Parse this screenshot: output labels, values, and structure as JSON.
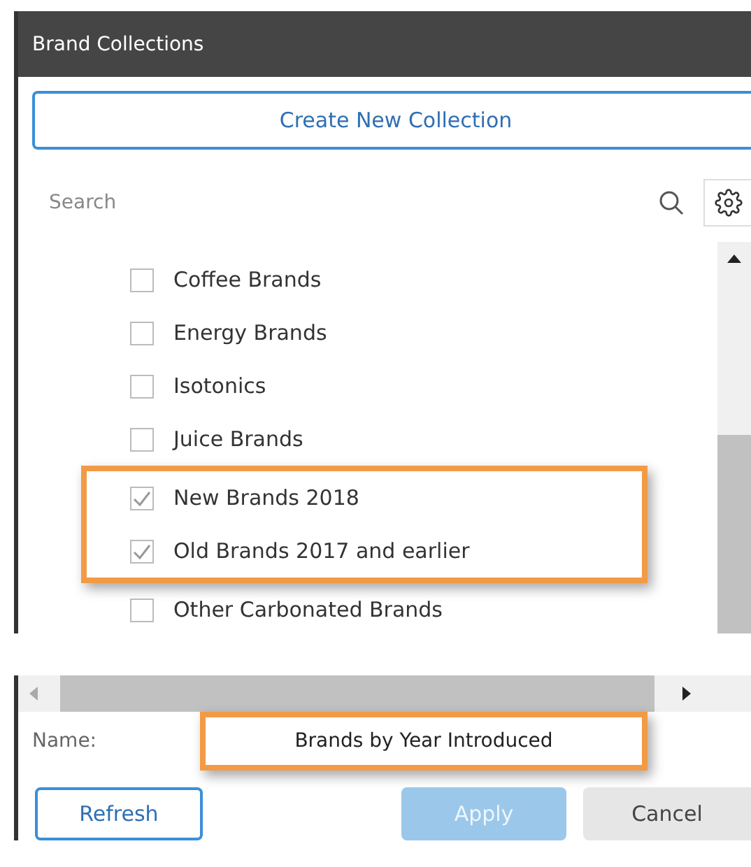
{
  "window": {
    "title": "Brand Collections"
  },
  "create_button": {
    "label": "Create New Collection"
  },
  "search": {
    "placeholder": "Search"
  },
  "collections": [
    {
      "label": "Coffee Brands",
      "checked": false,
      "highlighted": false
    },
    {
      "label": "Energy Brands",
      "checked": false,
      "highlighted": false
    },
    {
      "label": "Isotonics",
      "checked": false,
      "highlighted": false
    },
    {
      "label": "Juice Brands",
      "checked": false,
      "highlighted": false
    },
    {
      "label": "New Brands 2018",
      "checked": true,
      "highlighted": true
    },
    {
      "label": "Old Brands 2017 and earlier",
      "checked": true,
      "highlighted": true
    },
    {
      "label": "Other Carbonated Brands",
      "checked": false,
      "highlighted": false
    }
  ],
  "name_field": {
    "label": "Name:",
    "value": "Brands by Year Introduced",
    "highlighted": true
  },
  "buttons": [
    {
      "label": "Refresh",
      "kind": "outline",
      "disabled": false
    },
    {
      "label": "Apply",
      "kind": "primary",
      "disabled": true
    },
    {
      "label": "Cancel",
      "kind": "plain",
      "disabled": false
    }
  ]
}
